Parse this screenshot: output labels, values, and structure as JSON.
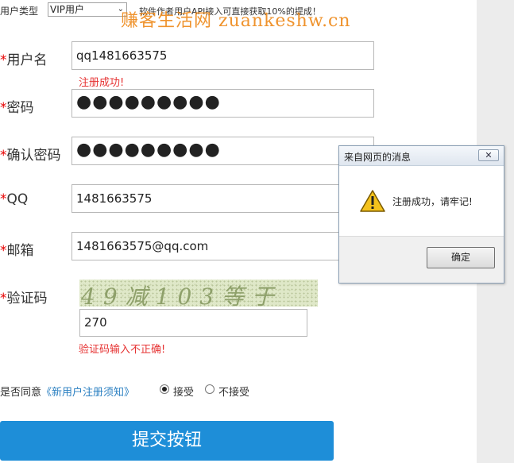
{
  "topbar": {
    "user_type_label": "用户类型",
    "user_type_value": "VIP用户",
    "notice": "软件作者用户API接入可直接获取10%的提成！",
    "watermark": "赚客生活网 zuankeshw.cn"
  },
  "form": {
    "required_mark": "*",
    "username_label": "用户名",
    "username_value": "qq1481663575",
    "username_msg": "注册成功!",
    "password_label": "密码",
    "password_value": "●●●●●●●●●",
    "confirm_label": "确认密码",
    "confirm_value": "●●●●●●●●●",
    "qq_label": "QQ",
    "qq_value": "1481663575",
    "email_label": "邮箱",
    "email_value": "1481663575@qq.com",
    "captcha_label": "验证码",
    "captcha_text": "49减103等于",
    "captcha_value": "270",
    "captcha_msg": "验证码输入不正确!"
  },
  "agreement": {
    "prefix": "是否同意",
    "link": "《新用户注册须知》",
    "accept": "接受",
    "reject": "不接受",
    "selected": "accept"
  },
  "submit_label": "提交按钮",
  "dialog": {
    "title": "来自网页的消息",
    "close_symbol": "✕",
    "message": "注册成功，请牢记!",
    "ok_label": "确定"
  },
  "colors": {
    "accent": "#1e8ed8",
    "error": "#e63333",
    "required": "#e60000",
    "link": "#2a7fc1",
    "watermark": "#ee8a1c"
  }
}
